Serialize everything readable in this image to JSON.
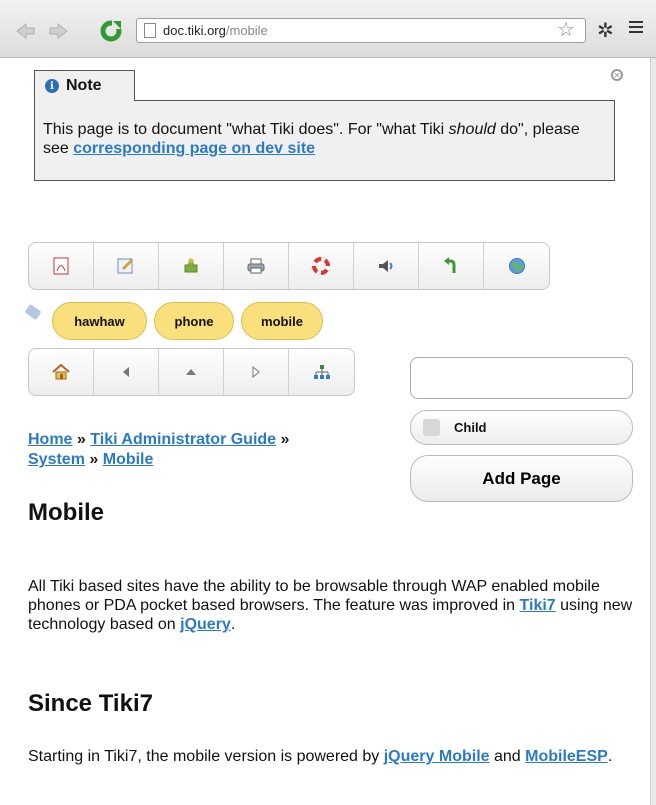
{
  "browser": {
    "url_host": "doc.tiki.org",
    "url_path": "/mobile"
  },
  "note": {
    "title": "Note",
    "text_before": "This page is to document \"what Tiki does\". For \"what Tiki ",
    "text_em": "should",
    "text_mid": " do\", please see ",
    "link": "corresponding page on dev site"
  },
  "toolbar_icons": [
    "pdf-icon",
    "edit-icon",
    "plugin-icon",
    "print-icon",
    "lifesaver-icon",
    "speaker-icon",
    "undo-arrow-icon",
    "globe-icon"
  ],
  "tags": [
    "hawhaw",
    "phone",
    "mobile"
  ],
  "nav_icons": [
    "home-icon",
    "arrow-left-icon",
    "arrow-up-icon",
    "arrow-right-icon",
    "sitemap-icon"
  ],
  "form": {
    "page_name_value": "",
    "child_label": "Child",
    "add_label": "Add Page"
  },
  "breadcrumb": {
    "home": "Home",
    "admin_guide": "Tiki Administrator Guide",
    "system": "System",
    "mobile": "Mobile",
    "sep": "»"
  },
  "content": {
    "title": "Mobile",
    "p1_a": "All Tiki based sites have the ability to be browsable through WAP enabled mobile phones or PDA pocket based browsers. The feature was improved in ",
    "p1_link1": "Tiki7",
    "p1_b": " using new technology based on ",
    "p1_link2": "jQuery",
    "p1_c": ".",
    "h2": "Since Tiki7",
    "p2_a": "Starting in Tiki7, the mobile version is powered by ",
    "p2_link1": "jQuery Mobile",
    "p2_b": " and ",
    "p2_link2": "MobileESP",
    "p2_c": "."
  }
}
